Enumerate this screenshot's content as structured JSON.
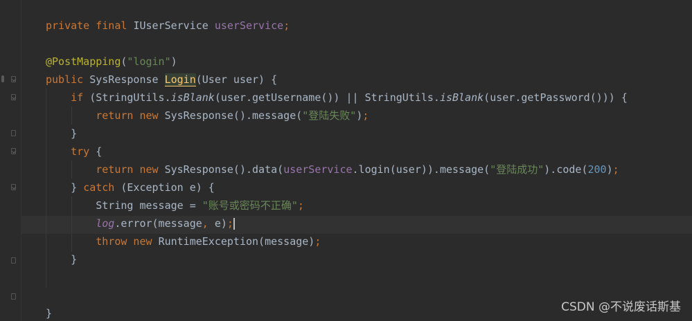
{
  "lines": [
    {
      "tokens": [
        {
          "t": "private final ",
          "c": "kw"
        },
        {
          "t": "IUserService ",
          "c": ""
        },
        {
          "t": "userService",
          "c": "field"
        },
        {
          "t": ";",
          "c": "kw"
        }
      ]
    },
    {
      "tokens": []
    },
    {
      "tokens": [
        {
          "t": "@PostMapping",
          "c": "ann"
        },
        {
          "t": "(",
          "c": ""
        },
        {
          "t": "\"login\"",
          "c": "str"
        },
        {
          "t": ")",
          "c": ""
        }
      ]
    },
    {
      "tokens": [
        {
          "t": "public ",
          "c": "kw"
        },
        {
          "t": "SysResponse ",
          "c": ""
        },
        {
          "t": "Login",
          "c": "method-hl"
        },
        {
          "t": "(User user) {",
          "c": ""
        }
      ]
    },
    {
      "tokens": [
        {
          "t": "    if ",
          "c": "kw"
        },
        {
          "t": "(StringUtils.",
          "c": ""
        },
        {
          "t": "isBlank",
          "c": "italic"
        },
        {
          "t": "(user.getUsername()) || StringUtils.",
          "c": ""
        },
        {
          "t": "isBlank",
          "c": "italic"
        },
        {
          "t": "(user.getPassword())) {",
          "c": ""
        }
      ]
    },
    {
      "tokens": [
        {
          "t": "        return new ",
          "c": "kw"
        },
        {
          "t": "SysResponse().message(",
          "c": ""
        },
        {
          "t": "\"登陆失败\"",
          "c": "str"
        },
        {
          "t": ")",
          "c": ""
        },
        {
          "t": ";",
          "c": "kw"
        }
      ]
    },
    {
      "tokens": [
        {
          "t": "    }",
          "c": ""
        }
      ]
    },
    {
      "tokens": [
        {
          "t": "    try ",
          "c": "kw"
        },
        {
          "t": "{",
          "c": ""
        }
      ]
    },
    {
      "tokens": [
        {
          "t": "        return new ",
          "c": "kw"
        },
        {
          "t": "SysResponse().data(",
          "c": ""
        },
        {
          "t": "userService",
          "c": "field"
        },
        {
          "t": ".login(user)).message(",
          "c": ""
        },
        {
          "t": "\"登陆成功\"",
          "c": "str"
        },
        {
          "t": ").code(",
          "c": ""
        },
        {
          "t": "200",
          "c": "num"
        },
        {
          "t": ")",
          "c": ""
        },
        {
          "t": ";",
          "c": "kw"
        }
      ]
    },
    {
      "tokens": [
        {
          "t": "    } ",
          "c": ""
        },
        {
          "t": "catch ",
          "c": "kw"
        },
        {
          "t": "(Exception e) {",
          "c": ""
        }
      ]
    },
    {
      "tokens": [
        {
          "t": "        String message = ",
          "c": ""
        },
        {
          "t": "\"账号或密码不正确\"",
          "c": "str"
        },
        {
          "t": ";",
          "c": "kw"
        }
      ]
    },
    {
      "tokens": [
        {
          "t": "        ",
          "c": ""
        },
        {
          "t": "log",
          "c": "field italic"
        },
        {
          "t": ".error(message",
          "c": ""
        },
        {
          "t": ", ",
          "c": "kw"
        },
        {
          "t": "e)",
          "c": ""
        },
        {
          "t": ";",
          "c": "kw"
        }
      ],
      "cursor": true
    },
    {
      "tokens": [
        {
          "t": "        throw new ",
          "c": "kw"
        },
        {
          "t": "RuntimeException(message)",
          "c": ""
        },
        {
          "t": ";",
          "c": "kw"
        }
      ]
    },
    {
      "tokens": [
        {
          "t": "    }",
          "c": ""
        }
      ]
    },
    {
      "tokens": []
    },
    {
      "tokens": []
    },
    {
      "tokens": [
        {
          "t": "}",
          "c": ""
        }
      ]
    }
  ],
  "watermark": "CSDN @不说废话斯基"
}
